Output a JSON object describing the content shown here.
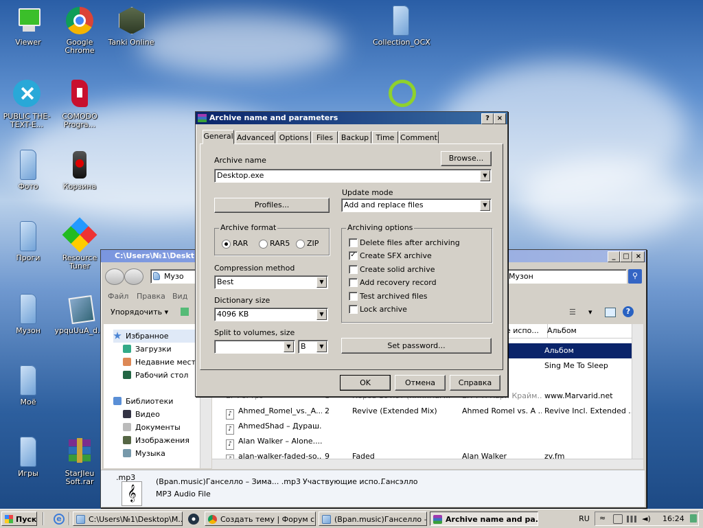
{
  "desktop": {
    "icons": [
      {
        "label": "Viewer",
        "icon": "monitor-icon"
      },
      {
        "label": "Google Chrome",
        "icon": "chrome-icon"
      },
      {
        "label": "Tanki Online",
        "icon": "tank-icon"
      },
      {
        "label": "Collection_OCX",
        "icon": "folder-icon"
      },
      {
        "label": "PUBLIC THE-TEXT-E...",
        "icon": "tools-icon"
      },
      {
        "label": "COMODO Progra...",
        "icon": "comodo-icon"
      },
      {
        "label": "Фото",
        "icon": "folder-icon"
      },
      {
        "label": "Корзина",
        "icon": "recycle-bin-icon"
      },
      {
        "label": "Проги",
        "icon": "folder-icon"
      },
      {
        "label": "Resource Tuner",
        "icon": "resource-tuner-icon"
      },
      {
        "label": "Музон",
        "icon": "folder-icon"
      },
      {
        "label": "ypquUuA_d...",
        "icon": "image-file-icon"
      },
      {
        "label": "Моё",
        "icon": "folder-icon"
      },
      {
        "label": "Игры",
        "icon": "folder-icon"
      },
      {
        "label": "StarJIeu Soft.rar",
        "icon": "winrar-archive-icon"
      }
    ]
  },
  "explorer": {
    "title": "C:\\Users\\№1\\Deskt",
    "address": "Музо",
    "search": "Музон",
    "menu": [
      "Файл",
      "Правка",
      "Вид"
    ],
    "organize": "Упорядочить",
    "nav": {
      "favorites": "Избранное",
      "downloads": "Загрузки",
      "recent": "Недавние места",
      "desktop": "Рабочий стол",
      "libraries": "Библиотеки",
      "video": "Видео",
      "documents": "Документы",
      "images": "Изображения",
      "music": "Музыка"
    },
    "columns": {
      "artists": "е испо...",
      "album": "Альбом"
    },
    "rows": [
      {
        "name": "",
        "num": "",
        "title": "",
        "artist": "",
        "album": "Альбом"
      },
      {
        "name": "",
        "num": "",
        "title": "",
        "artist": "",
        "album": "Sing Me To Sleep"
      },
      {
        "name": "",
        "num": "",
        "title": "",
        "artist": "",
        "album": ""
      },
      {
        "name": "Ег Рогтрэ",
        "num": "1",
        "title": "Норов 1с лот (ннннмаг...",
        "artist": "ЕК Т П Карп Крайм...",
        "album": "www.Marvarid.net"
      },
      {
        "name": "Ahmed_Romel_vs._A...",
        "num": "2",
        "title": "Revive (Extended Mix)",
        "artist": "Ahmed Romel vs. A ...",
        "album": "Revive Incl. Extended ..."
      },
      {
        "name": "AhmedShad – Дураш...",
        "num": "",
        "title": "",
        "artist": "",
        "album": ""
      },
      {
        "name": "Alan Walker – Alone....",
        "num": "",
        "title": "",
        "artist": "",
        "album": ""
      },
      {
        "name": "alan-walker-faded-so...",
        "num": "9",
        "title": "Faded",
        "artist": "Alan Walker",
        "album": "zv.fm"
      }
    ],
    "details": {
      "ext": ".mp3",
      "name": "(Bpan.music)Ганселло – Зима... .mp3",
      "participating_label": "Участвующие испо...",
      "participating_value": "Гансэлло",
      "type": "MP3 Audio File"
    }
  },
  "dialog": {
    "title": "Archive name and parameters",
    "help_btn": "?",
    "close_btn": "×",
    "tabs": [
      "General",
      "Advanced",
      "Options",
      "Files",
      "Backup",
      "Time",
      "Comment"
    ],
    "archive_name_label": "Archive name",
    "browse": "Browse...",
    "archive_name": "Desktop.exe",
    "update_mode_label": "Update mode",
    "update_mode": "Add and replace files",
    "profiles": "Profiles...",
    "archive_format_label": "Archive format",
    "formats": [
      "RAR",
      "RAR5",
      "ZIP"
    ],
    "selected_format": "RAR",
    "compression_method_label": "Compression method",
    "compression_method": "Best",
    "dictionary_size_label": "Dictionary size",
    "dictionary_size": "4096 KB",
    "split_label": "Split to volumes, size",
    "split_value": "",
    "split_unit": "B",
    "archiving_options_label": "Archiving options",
    "options": [
      {
        "label": "Delete files after archiving",
        "checked": false
      },
      {
        "label": "Create SFX archive",
        "checked": true
      },
      {
        "label": "Create solid archive",
        "checked": false
      },
      {
        "label": "Add recovery record",
        "checked": false
      },
      {
        "label": "Test archived files",
        "checked": false
      },
      {
        "label": "Lock archive",
        "checked": false
      }
    ],
    "set_password": "Set password...",
    "ok": "OK",
    "cancel": "Отмена",
    "help": "Справка"
  },
  "taskbar": {
    "start": "Пуск",
    "tasks": [
      {
        "label": "C:\\Users\\№1\\Desktop\\М...",
        "pressed": false
      },
      {
        "label": "Создать тему | Форум с...",
        "pressed": false
      },
      {
        "label": "(Bpan.music)Ганселло –...",
        "pressed": false
      },
      {
        "label": "Archive name and pa...",
        "pressed": true
      }
    ],
    "lang": "RU",
    "clock": "16:24"
  },
  "colors": {
    "titlebar_active": "#0a246a",
    "selection": "#0a246a",
    "face": "#d4d0c8"
  }
}
